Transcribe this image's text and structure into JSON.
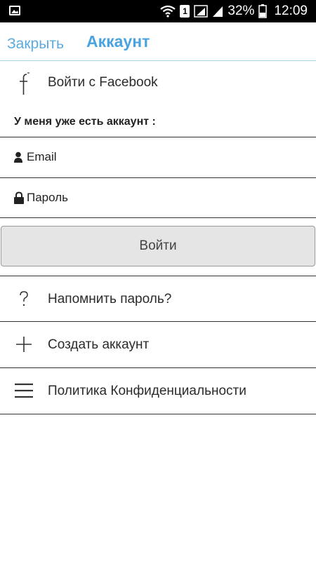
{
  "status_bar": {
    "battery": "32%",
    "time": "12:09",
    "sim_slot": "1",
    "icons": [
      "gallery-icon",
      "wifi-icon",
      "sim-icon",
      "signal-icon",
      "battery-icon"
    ]
  },
  "header": {
    "close_label": "Закрыть",
    "title": "Аккаунт"
  },
  "facebook": {
    "label": "Войти с Facebook",
    "icon": "facebook-icon"
  },
  "login": {
    "section_label": "У меня уже есть аккаунт :",
    "email_placeholder": "Email",
    "password_placeholder": "Пароль",
    "submit_label": "Войти"
  },
  "menu": {
    "items": [
      {
        "label": "Напомнить пароль?",
        "icon": "question-icon"
      },
      {
        "label": "Создать аккаунт",
        "icon": "plus-icon"
      },
      {
        "label": "Политика Конфиденциальности",
        "icon": "menu-lines-icon"
      }
    ]
  },
  "colors": {
    "accent": "#4aa3e0",
    "status_bar_bg": "#000000",
    "button_bg": "#e5e5e5"
  }
}
